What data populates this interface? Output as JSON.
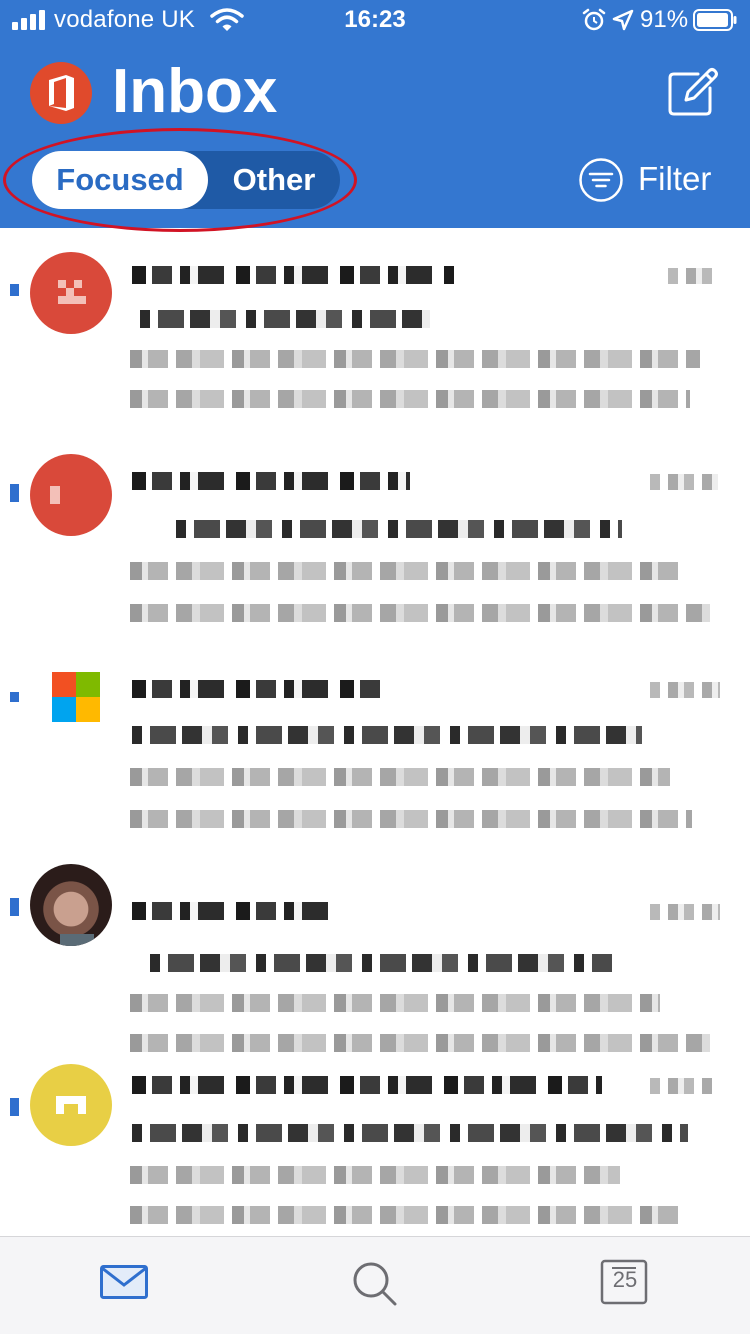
{
  "status_bar": {
    "carrier": "vodafone UK",
    "time": "16:23",
    "battery_percent": "91%",
    "signal_bars": 4,
    "icons": [
      "signal-icon",
      "wifi-icon",
      "alarm-icon",
      "location-arrow-icon",
      "battery-icon"
    ]
  },
  "header": {
    "app_logo": "office-logo-icon",
    "title": "Inbox",
    "compose_icon": "compose-icon",
    "tabs": [
      {
        "label": "Focused",
        "selected": true
      },
      {
        "label": "Other",
        "selected": false
      }
    ],
    "filter_label": "Filter",
    "colors": {
      "header_bg": "#3477d0",
      "segment_bg": "#1f5aa6",
      "highlight_ring": "#d11324"
    }
  },
  "messages": [
    {
      "unread": true,
      "avatar": "red-avatar",
      "avatar_color": "#d9493a",
      "content_obscured": true
    },
    {
      "unread": true,
      "avatar": "red-avatar",
      "avatar_color": "#d9493a",
      "content_obscured": true
    },
    {
      "unread": true,
      "avatar": "microsoft-logo",
      "content_obscured": true
    },
    {
      "unread": true,
      "avatar": "photo-avatar",
      "content_obscured": true
    },
    {
      "unread": true,
      "avatar": "yellow-avatar",
      "avatar_color": "#e8cf45",
      "content_obscured": true
    }
  ],
  "tab_bar": {
    "items": [
      {
        "name": "mail",
        "icon": "mail-icon",
        "selected": true
      },
      {
        "name": "search",
        "icon": "search-icon",
        "selected": false
      },
      {
        "name": "calendar",
        "icon": "calendar-icon",
        "selected": false,
        "badge": "25"
      }
    ],
    "colors": {
      "active": "#2f6fce",
      "inactive": "#6d6d72"
    }
  }
}
